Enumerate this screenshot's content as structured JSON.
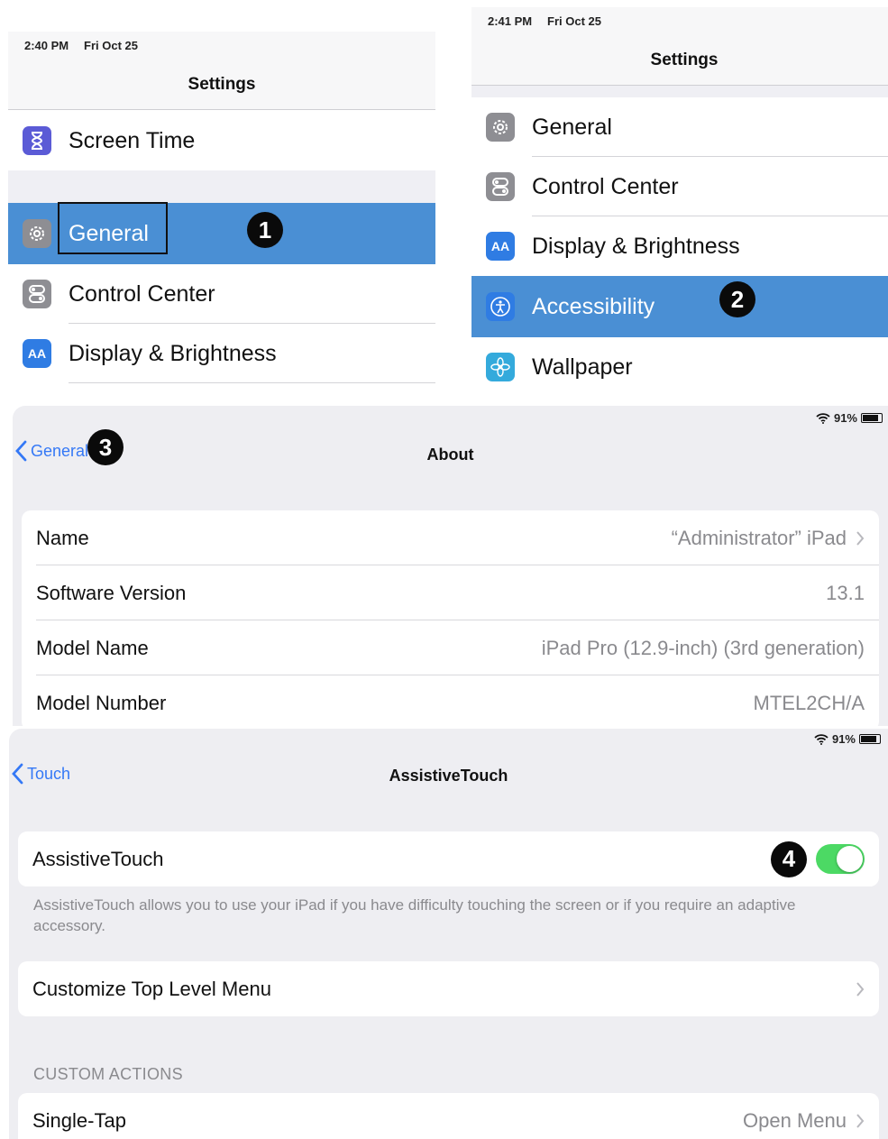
{
  "panel1": {
    "time": "2:40 PM",
    "date": "Fri Oct 25",
    "title": "Settings",
    "items": [
      {
        "label": "Screen Time",
        "icon": "hourglass-icon"
      },
      {
        "label": "General",
        "icon": "gear-icon"
      },
      {
        "label": "Control Center",
        "icon": "toggles-icon"
      },
      {
        "label": "Display & Brightness",
        "icon": "text-size-icon"
      }
    ],
    "badge": "1"
  },
  "panel2": {
    "time": "2:41 PM",
    "date": "Fri Oct 25",
    "title": "Settings",
    "items": [
      {
        "label": "General",
        "icon": "gear-icon"
      },
      {
        "label": "Control Center",
        "icon": "toggles-icon"
      },
      {
        "label": "Display & Brightness",
        "icon": "text-size-icon"
      },
      {
        "label": "Accessibility",
        "icon": "accessibility-icon"
      },
      {
        "label": "Wallpaper",
        "icon": "flower-icon"
      }
    ],
    "badge": "2"
  },
  "panel3": {
    "battery": "91%",
    "back_label": "General",
    "title": "About",
    "badge": "3",
    "rows": [
      {
        "key": "Name",
        "value": "“Administrator” iPad"
      },
      {
        "key": "Software Version",
        "value": "13.1"
      },
      {
        "key": "Model Name",
        "value": "iPad Pro (12.9-inch) (3rd generation)"
      },
      {
        "key": "Model Number",
        "value": "MTEL2CH/A"
      }
    ]
  },
  "panel4": {
    "battery": "91%",
    "back_label": "Touch",
    "title": "AssistiveTouch",
    "badge": "4",
    "toggle_label": "AssistiveTouch",
    "toggle_on": true,
    "footnote": "AssistiveTouch allows you to use your iPad if you have difficulty touching the screen or if you require an adaptive accessory.",
    "customize_label": "Customize Top Level Menu",
    "section_header": "CUSTOM ACTIONS",
    "single_tap_label": "Single-Tap",
    "single_tap_value": "Open Menu"
  },
  "colors": {
    "selection": "#4a8fd4",
    "link": "#3478f6",
    "toggle_on": "#4cd964"
  }
}
